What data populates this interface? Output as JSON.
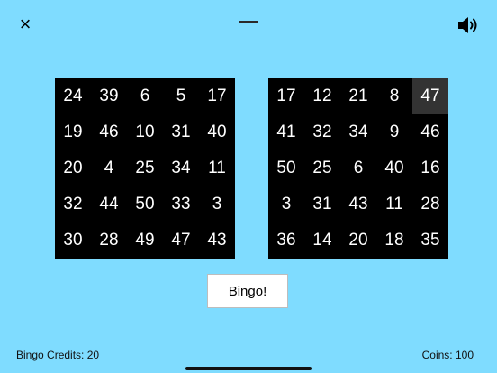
{
  "controls": {
    "close_glyph": "×"
  },
  "boards": [
    {
      "name": "left",
      "cells": [
        24,
        39,
        6,
        5,
        17,
        19,
        46,
        10,
        31,
        40,
        20,
        4,
        25,
        34,
        11,
        32,
        44,
        50,
        33,
        3,
        30,
        28,
        49,
        47,
        43
      ],
      "marked": []
    },
    {
      "name": "right",
      "cells": [
        17,
        12,
        21,
        8,
        47,
        41,
        32,
        34,
        9,
        46,
        50,
        25,
        6,
        40,
        16,
        3,
        31,
        43,
        11,
        28,
        36,
        14,
        20,
        18,
        35
      ],
      "marked": [
        4
      ]
    }
  ],
  "actions": {
    "bingo_label": "Bingo!"
  },
  "status": {
    "credits_text": "Bingo Credits: 20",
    "coins_text": "Coins: 100"
  },
  "colors": {
    "background": "#7fdcff",
    "board": "#000000",
    "marked_cell": "#333333"
  }
}
